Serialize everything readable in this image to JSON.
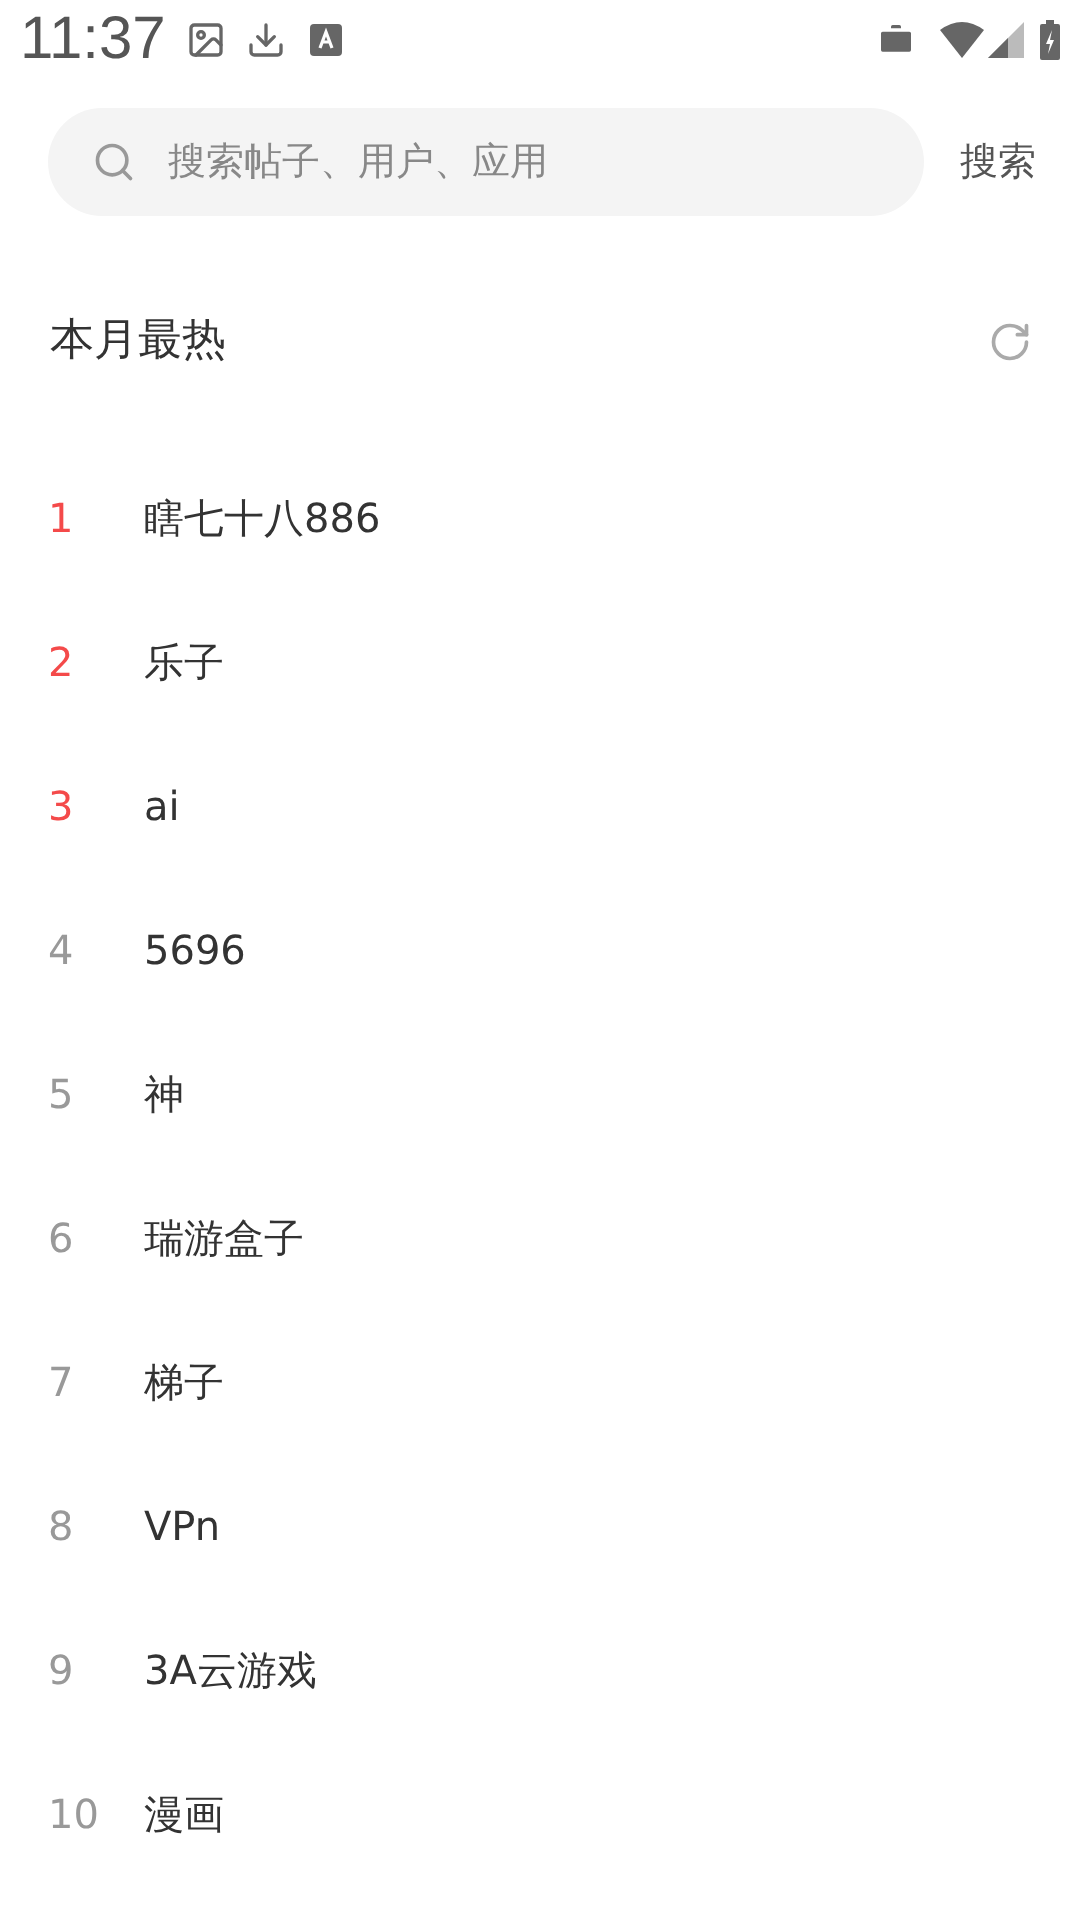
{
  "status_bar": {
    "time": "11:37"
  },
  "search": {
    "placeholder": "搜索帖子、用户、应用",
    "button": "搜索"
  },
  "section": {
    "title": "本月最热"
  },
  "items": [
    {
      "rank": "1",
      "label": "瞎七十八886",
      "hot": true
    },
    {
      "rank": "2",
      "label": "乐子",
      "hot": true
    },
    {
      "rank": "3",
      "label": "ai",
      "hot": true
    },
    {
      "rank": "4",
      "label": "5696",
      "hot": false
    },
    {
      "rank": "5",
      "label": "神",
      "hot": false
    },
    {
      "rank": "6",
      "label": "瑞游盒子",
      "hot": false
    },
    {
      "rank": "7",
      "label": "梯子",
      "hot": false
    },
    {
      "rank": "8",
      "label": "VPn",
      "hot": false
    },
    {
      "rank": "9",
      "label": "3A云游戏",
      "hot": false
    },
    {
      "rank": "10",
      "label": "漫画",
      "hot": false
    }
  ]
}
